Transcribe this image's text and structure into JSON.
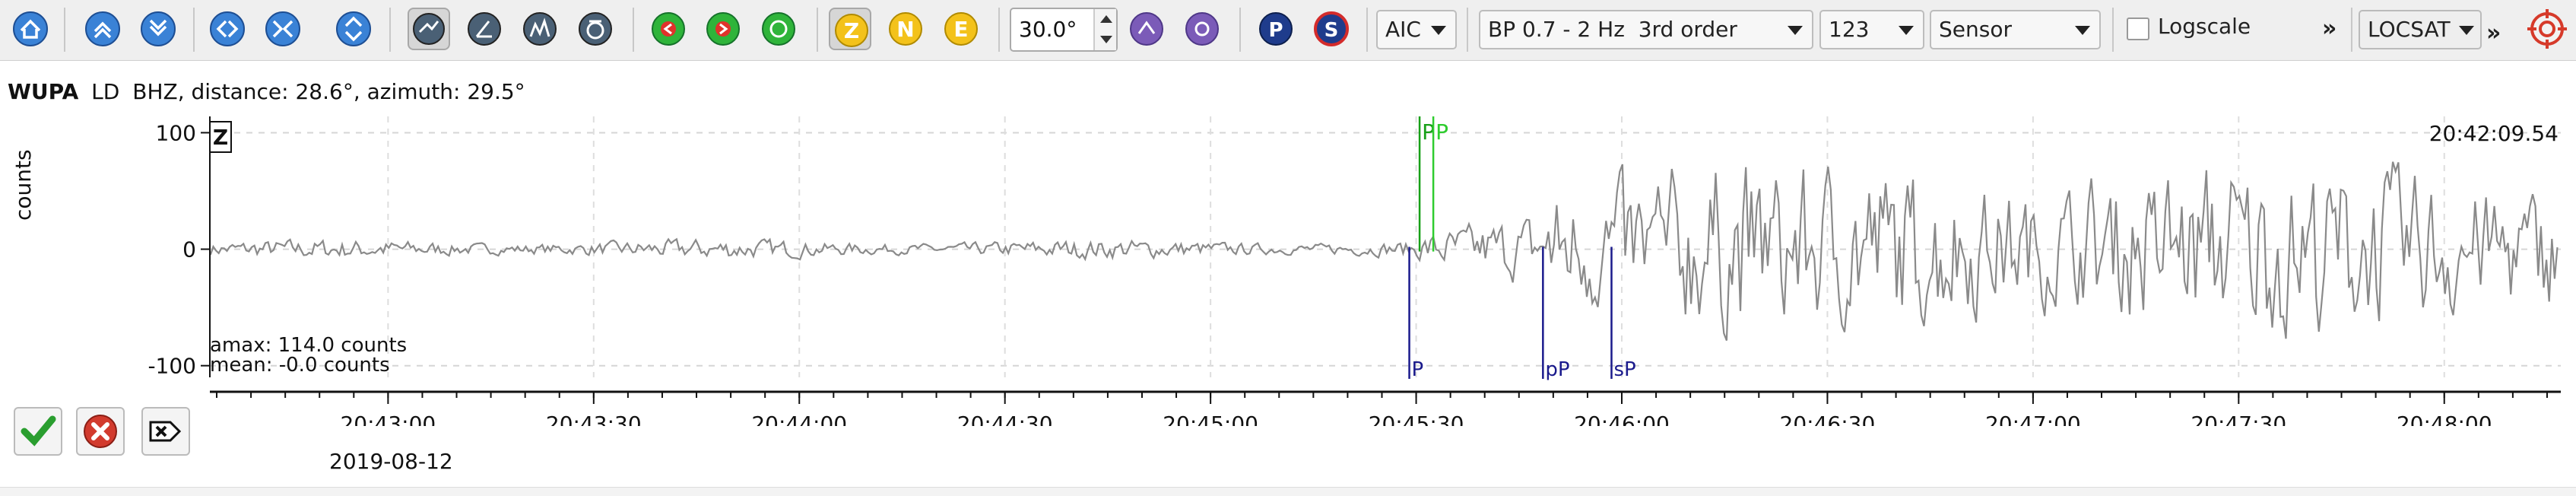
{
  "toolbar": {
    "phase_buttons": [
      "Z",
      "N",
      "E"
    ],
    "slowness_value": "30.0°",
    "channel_buttons": [
      "P",
      "S"
    ],
    "picker": "AIC",
    "filter": "BP 0.7 - 2 Hz  3rd order",
    "components": "123",
    "amplitude_mode": "Sensor",
    "logscale_label": "Logscale",
    "logscale_checked": false,
    "locator": "LOCSAT",
    "overflow_glyph": "»"
  },
  "station": {
    "code": "WUPA",
    "network": "LD",
    "channel": "BHZ",
    "info": "distance: 28.6°, azimuth: 29.5°",
    "component_badge": "Z",
    "end_time": "20:42:09.54",
    "y_axis_label": "counts",
    "amax_text": "amax: 114.0 counts",
    "mean_text": "mean: -0.0 counts",
    "date": "2019-08-12"
  },
  "picks": {
    "top": [
      {
        "label": "P",
        "time_s": 1530.5,
        "color": "#18a018"
      },
      {
        "label": "P",
        "time_s": 1532.5,
        "color": "#2ecc2e"
      }
    ],
    "bottom": [
      {
        "label": "P",
        "time_s": 1529.0,
        "color": "#1a1a8c"
      },
      {
        "label": "pP",
        "time_s": 1548.5,
        "color": "#1a1a8c"
      },
      {
        "label": "sP",
        "time_s": 1558.5,
        "color": "#1a1a8c"
      }
    ]
  },
  "chart_data": {
    "type": "line",
    "xlabel": "",
    "ylabel": "counts",
    "x_tick_labels": [
      "20:43:00",
      "20:43:30",
      "20:44:00",
      "20:44:30",
      "20:45:00",
      "20:45:30",
      "20:46:00",
      "20:46:30",
      "20:47:00",
      "20:47:30",
      "20:48:00"
    ],
    "x_tick_seconds": [
      1380,
      1410,
      1440,
      1470,
      1500,
      1530,
      1560,
      1590,
      1620,
      1650,
      1680
    ],
    "xlim_seconds_from_20_20_00": [
      1354,
      1697
    ],
    "y_ticks": [
      100,
      0,
      -100
    ],
    "ylim": [
      -110,
      114
    ],
    "grid": true,
    "series": [
      {
        "color": "#8a8a8a"
      }
    ]
  }
}
